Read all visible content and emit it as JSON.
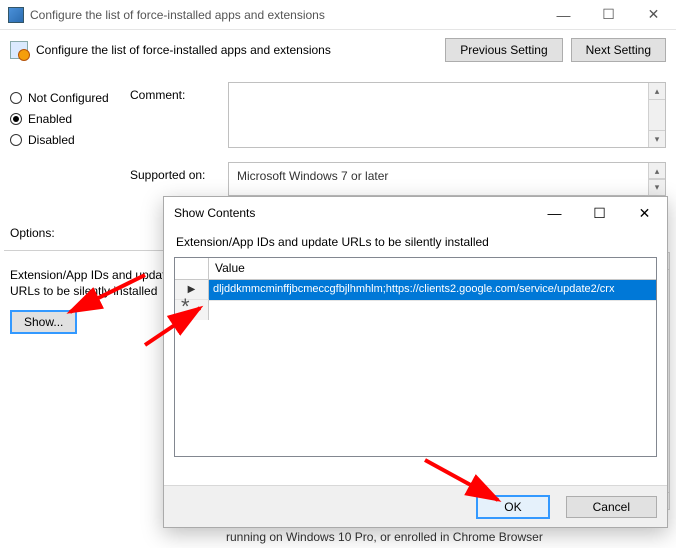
{
  "window": {
    "title": "Configure the list of force-installed apps and extensions",
    "minimize_glyph": "—",
    "maximize_glyph": "☐",
    "close_glyph": "✕"
  },
  "header": {
    "title": "Configure the list of force-installed apps and extensions",
    "prev_label": "Previous Setting",
    "next_label": "Next Setting"
  },
  "policy_state": {
    "not_configured": "Not Configured",
    "enabled": "Enabled",
    "disabled": "Disabled",
    "selected": "enabled"
  },
  "labels": {
    "comment": "Comment:",
    "supported_on": "Supported on:",
    "options": "Options:",
    "scroll_up": "▴",
    "scroll_down": "▾"
  },
  "supported_value": "Microsoft Windows 7 or later",
  "options": {
    "field_label": "Extension/App IDs and update URLs to be silently installed",
    "show_button": "Show..."
  },
  "footer_text": "running on Windows 10 Pro, or enrolled in Chrome Browser",
  "dialog": {
    "title": "Show Contents",
    "minimize_glyph": "—",
    "maximize_glyph": "☐",
    "close_glyph": "✕",
    "subtitle": "Extension/App IDs and update URLs to be silently installed",
    "value_header": "Value",
    "row_indicator": "▶",
    "rows": [
      "dljddkmmcminffjbcmeccgfbjlhmhlm;https://clients2.google.com/service/update2/crx"
    ],
    "ok_label": "OK",
    "cancel_label": "Cancel"
  },
  "annotations": {
    "arrow_color": "#ff0000"
  }
}
